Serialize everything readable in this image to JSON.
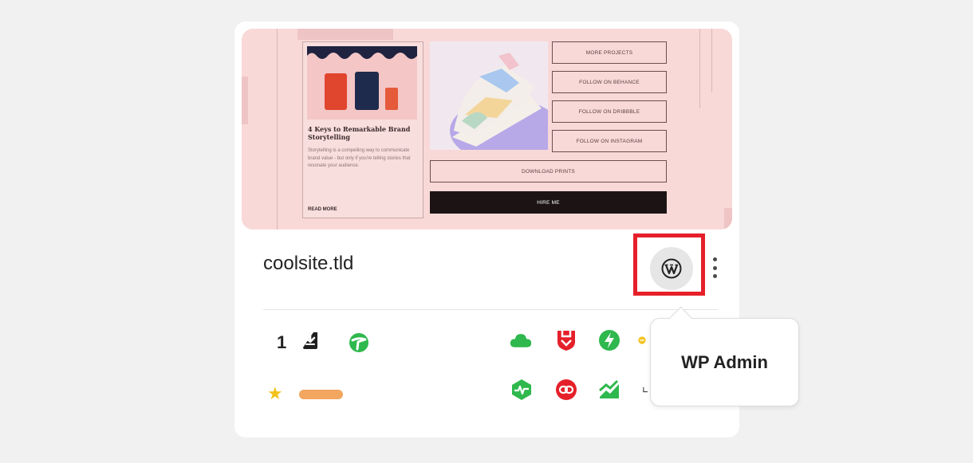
{
  "site": {
    "name": "coolsite.tld",
    "update_count": "1"
  },
  "thumbnail": {
    "blog_title": "4 Keys to Remarkable Brand Storytelling",
    "blog_excerpt": "Storytelling is a compelling way to communicate brand value - but only if you're telling stories that resonate your audience.",
    "read_more": "READ MORE",
    "buttons": [
      "MORE PROJECTS",
      "FOLLOW ON BEHANCE",
      "FOLLOW ON DRIBBBLE",
      "FOLLOW ON INSTAGRAM"
    ],
    "download": "DOWNLOAD PRINTS",
    "hire": "HIRE ME"
  },
  "tooltip": {
    "label": "WP Admin"
  },
  "icons": {
    "wordpress": "wordpress-icon",
    "more": "kebab-menu-icon",
    "update": "download-icon",
    "status": "uptime-icon",
    "cloud": "cloud-icon",
    "shield": "shield-icon",
    "performance": "lightning-icon",
    "activity": "activity-icon",
    "link": "link-icon",
    "analytics": "chart-icon",
    "favorite": "star-icon"
  },
  "colors": {
    "highlight": "#e5202a",
    "green": "#2fb84d",
    "red": "#e5202a",
    "star": "#f3c21a",
    "tag": "#f2a65f"
  }
}
